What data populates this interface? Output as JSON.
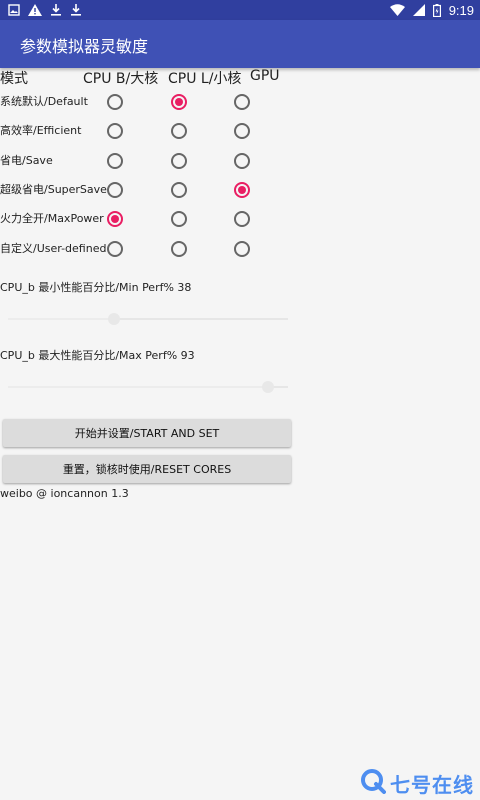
{
  "status_bar": {
    "time": "9:19",
    "left_icons": [
      "image-icon",
      "warning-icon",
      "download-icon",
      "download-icon"
    ],
    "right_icons": [
      "wifi-icon",
      "signal-icon",
      "battery-icon"
    ]
  },
  "app_bar": {
    "title": "参数模拟器灵敏度"
  },
  "table": {
    "headers": {
      "mode": "模式",
      "cpu_b": "CPU B/大核",
      "cpu_l": "CPU L/小核",
      "gpu": "GPU"
    },
    "rows": [
      {
        "label": "系统默认/Default",
        "cpu_b": false,
        "cpu_l": true,
        "gpu": false
      },
      {
        "label": "高效率/Efficient",
        "cpu_b": false,
        "cpu_l": false,
        "gpu": false
      },
      {
        "label": "省电/Save",
        "cpu_b": false,
        "cpu_l": false,
        "gpu": false
      },
      {
        "label": "超级省电/SuperSave",
        "cpu_b": false,
        "cpu_l": false,
        "gpu": true
      },
      {
        "label": "火力全开/MaxPower",
        "cpu_b": true,
        "cpu_l": false,
        "gpu": false
      },
      {
        "label": "自定义/User-defined",
        "cpu_b": false,
        "cpu_l": false,
        "gpu": false
      }
    ]
  },
  "min_perf": {
    "label": "CPU_b 最小性能百分比/Min Perf% 38",
    "value": 38
  },
  "max_perf": {
    "label": "CPU_b 最大性能百分比/Max Perf% 93",
    "value": 93
  },
  "buttons": {
    "start": "开始并设置/START AND SET",
    "reset": "重置，锁核时使用/RESET CORES"
  },
  "footer": "weibo @ ioncannon 1.3",
  "watermark": {
    "text": "七号在线",
    "color": "#4e8ef0"
  },
  "colors": {
    "accent": "#e91e63",
    "primary": "#3f51b5",
    "primary_dark": "#303f9f"
  }
}
